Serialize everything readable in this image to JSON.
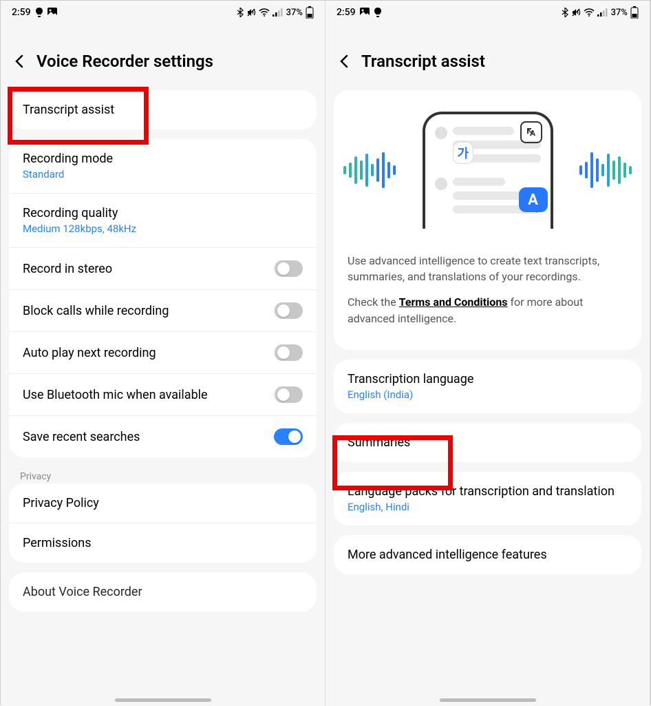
{
  "status": {
    "time": "2:59",
    "battery": "37%"
  },
  "left": {
    "title": "Voice Recorder settings",
    "items": {
      "transcript": "Transcript assist",
      "recmode_t": "Recording mode",
      "recmode_s": "Standard",
      "recq_t": "Recording quality",
      "recq_s": "Medium 128kbps, 48kHz",
      "stereo": "Record in stereo",
      "block": "Block calls while recording",
      "autoplay": "Auto play next recording",
      "btmic": "Use Bluetooth mic when available",
      "savesearch": "Save recent searches",
      "privacy_label": "Privacy",
      "privacy_policy": "Privacy Policy",
      "permissions": "Permissions",
      "about": "About Voice Recorder"
    }
  },
  "right": {
    "title": "Transcript assist",
    "desc1a": "Use advanced intelligence to create text transcripts, summaries, and translations of your recordings.",
    "desc2_pre": "Check the ",
    "desc2_link": "Terms and Conditions",
    "desc2_post": " for more about advanced intelligence.",
    "items": {
      "lang_t": "Transcription language",
      "lang_s": "English (India)",
      "summaries": "Summaries",
      "packs_t": "Language packs for transcription and translation",
      "packs_s": "English, Hindi",
      "more": "More advanced intelligence features"
    },
    "illus": {
      "ga": "가",
      "A": "A"
    }
  }
}
